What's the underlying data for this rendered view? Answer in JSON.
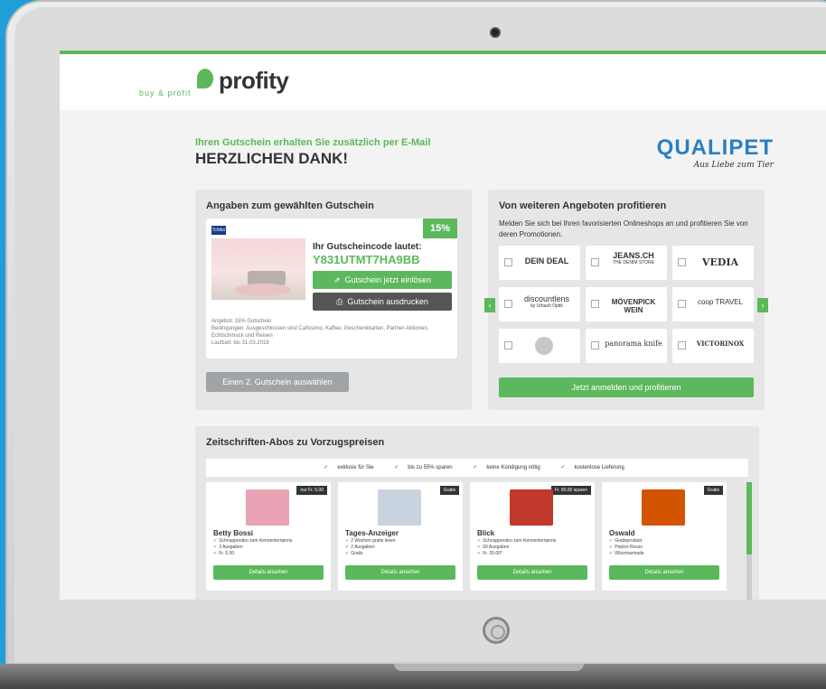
{
  "colors": {
    "accent": "#5cb85c",
    "dark": "#555555",
    "qualipet": "#2a7fc0",
    "background": "#1e9fd8"
  },
  "logo": {
    "name": "profity",
    "tagline": "buy & profit"
  },
  "thanks": {
    "subtitle": "Ihren Gutschein erhalten Sie zusätzlich per E-Mail",
    "title": "HERZLICHEN DANK!"
  },
  "partner": {
    "name": "QUALIPET",
    "tagline": "Aus Liebe zum Tier"
  },
  "voucher_panel": {
    "title": "Angaben zum gewählten Gutschein",
    "discount": "15%",
    "brand": "Tchibo",
    "code_label": "Ihr Gutscheincode lautet:",
    "code": "Y831UTMT7HA9BB",
    "redeem_button": "Gutschein jetzt einlösen",
    "print_button": "Gutschein ausdrucken",
    "info": {
      "offer": "Angebot: 15% Gutschein",
      "conditions": "Bedingungen: Ausgeschlossen sind Cafissimo, Kaffee, Geschenkkarten, Partner-Aktionen, Echtschmuck und Reisen",
      "valid": "Laufzeit: bis 31.03.2018"
    },
    "second_button": "Einen 2. Gutschein auswählen"
  },
  "offers_panel": {
    "title": "Von weiteren Angeboten profitieren",
    "description": "Melden Sie sich bei Ihren favorisierten Onlineshops an und profitieren Sie von deren Promotionen.",
    "brands": [
      "DEIN DEAL",
      "JEANS.CH",
      "VEDIA",
      "discountlens",
      "MÖVENPICK WEIN",
      "coop TRAVEL",
      "",
      "panorama knife",
      "VICTORINOX"
    ],
    "brand_subtexts": [
      "",
      "THE DENIM STORE",
      "",
      "by Urbach Optik",
      "",
      "",
      "",
      "",
      ""
    ],
    "submit_button": "Jetzt anmelden und profitieren",
    "prev_icon": "chevron-left-icon",
    "next_icon": "chevron-right-icon"
  },
  "magazines_panel": {
    "title": "Zeitschriften-Abos zu Vorzugspreisen",
    "usps": [
      "exklusiv für Sie",
      "bis zu 55% sparen",
      "keine Kündigung nötig",
      "kostenlose Lieferung"
    ],
    "cards": [
      {
        "name": "Betty Bossi",
        "badge": "nur Fr. 5.00",
        "bullets": [
          "Schnupperabo zum Kennenlernpreis",
          "3 Ausgaben",
          "Fr. 5.00"
        ],
        "button": "Details ansehen",
        "thumb_color": "#e8a3b5"
      },
      {
        "name": "Tages-Anzeiger",
        "badge": "Gratis",
        "bullets": [
          "2 Wochen gratis lesen",
          "2 Ausgaben",
          "Gratis"
        ],
        "button": "Details ansehen",
        "thumb_color": "#c9d3e0"
      },
      {
        "name": "Blick",
        "badge": "Fr. 90.00 sparen",
        "bullets": [
          "Schnupperabo zum Kennenlernpreis",
          "50 Ausgaben",
          "Fr. 35.00*"
        ],
        "button": "Details ansehen",
        "thumb_color": "#c0392b"
      },
      {
        "name": "Oswald",
        "badge": "Gratis",
        "bullets": [
          "Gratisprodukt",
          "Pepizo Rosso",
          "Würzmarinade"
        ],
        "button": "Details ansehen",
        "thumb_color": "#d35400"
      }
    ]
  }
}
